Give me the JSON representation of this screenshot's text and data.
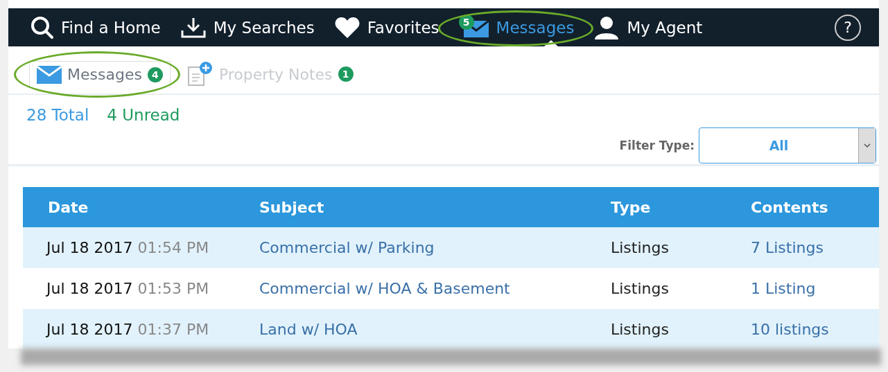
{
  "nav": [
    {
      "label": "Find a Home",
      "kind": "search",
      "selected": false,
      "highlighted": false
    },
    {
      "label": "My Searches",
      "kind": "download",
      "selected": false,
      "highlighted": false
    },
    {
      "label": "Favorites",
      "kind": "heart",
      "selected": false,
      "highlighted": false
    },
    {
      "label": "Messages",
      "kind": "mail",
      "badge": "5",
      "selected": true,
      "highlighted": true
    },
    {
      "label": "My Agent",
      "kind": "person",
      "selected": false,
      "highlighted": false
    }
  ],
  "help": {
    "label": "?"
  },
  "subtabs": [
    {
      "label": "Messages",
      "kind": "mail",
      "badge": "4",
      "selected": true,
      "highlighted": true
    },
    {
      "label": "Property Notes",
      "kind": "note",
      "badge": "1",
      "selected": false,
      "highlighted": false
    }
  ],
  "summary": {
    "total": "28 Total",
    "unread": "4 Unread"
  },
  "filter": {
    "label": "Filter Type:",
    "value": "All"
  },
  "table": {
    "columns": [
      "Date",
      "Subject",
      "Type",
      "Contents"
    ],
    "rows": [
      {
        "date": "Jul 18 2017",
        "time": "01:54 PM",
        "subject": "Commercial w/ Parking",
        "type": "Listings",
        "contents": "7 Listings"
      },
      {
        "date": "Jul 18 2017",
        "time": "01:53 PM",
        "subject": "Commercial w/ HOA & Basement",
        "type": "Listings",
        "contents": "1 Listing"
      },
      {
        "date": "Jul 18 2017",
        "time": "01:37 PM",
        "subject": "Land w/ HOA",
        "type": "Listings",
        "contents": "10 listings"
      }
    ]
  }
}
